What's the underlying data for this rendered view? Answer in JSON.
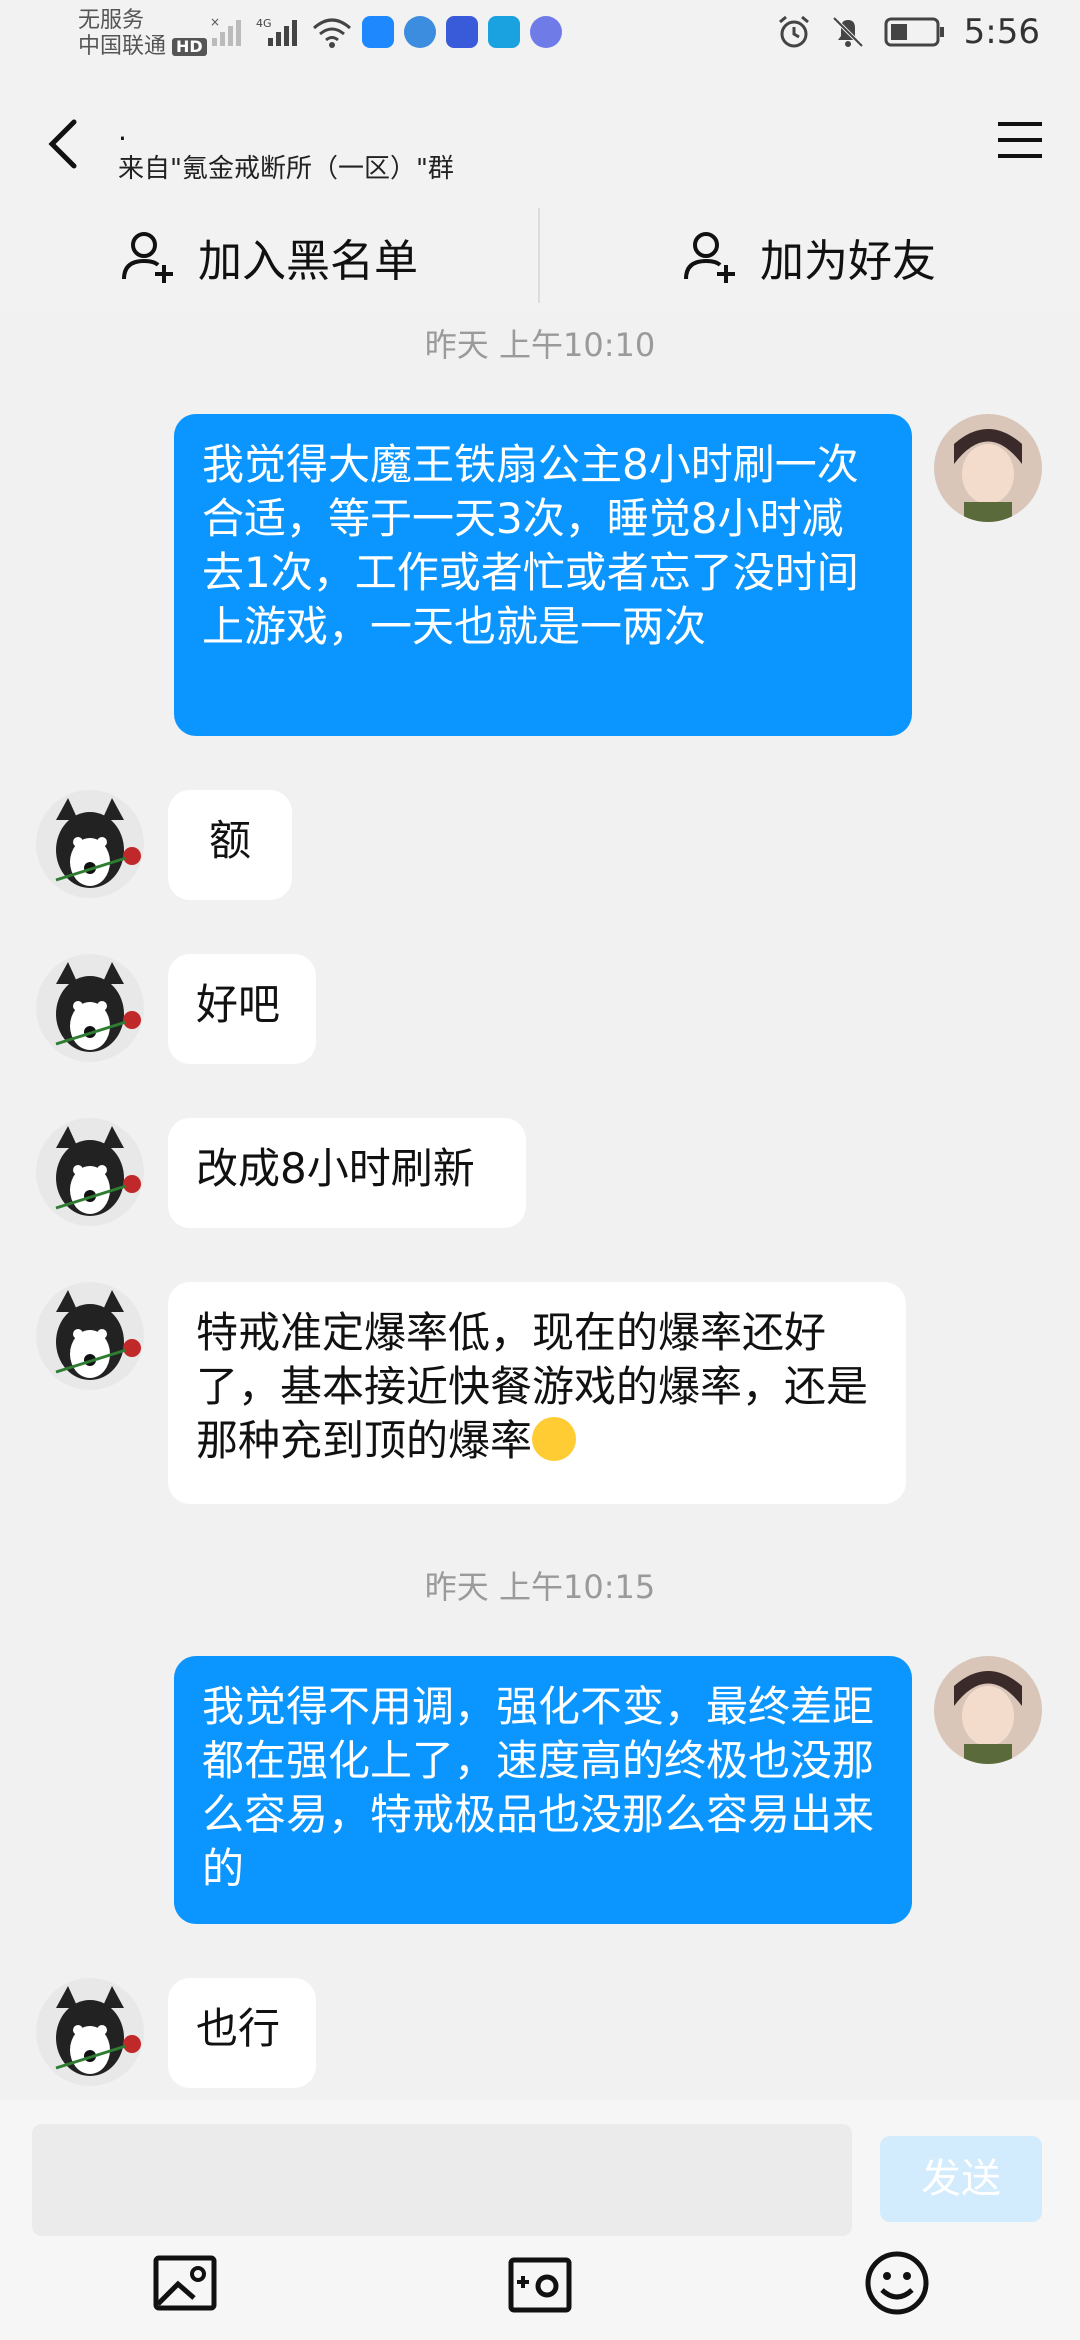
{
  "status_bar": {
    "carrier_line1": "无服务",
    "carrier_line2": "中国联通",
    "hd_badge": "HD",
    "network": "4G",
    "time": "5:56"
  },
  "header": {
    "title": ".",
    "subtitle": "来自\"氪金戒断所（一区）\"群"
  },
  "actions": {
    "blacklist_label": "加入黑名单",
    "add_friend_label": "加为好友"
  },
  "messages": {
    "ts1": "昨天 上午10:10",
    "m1": "我觉得大魔王铁扇公主8小时刷一次合适，等于一天3次，睡觉8小时减去1次，工作或者忙或者忘了没时间上游戏，一天也就是一两次",
    "m2": "额",
    "m3": "好吧",
    "m4": "改成8小时刷新",
    "m5": "特戒准定爆率低，现在的爆率还好了，基本接近快餐游戏的爆率，还是那种充到顶的爆率",
    "ts2": "昨天 上午10:15",
    "m6": "我觉得不用调，强化不变，最终差距都在强化上了，速度高的终极也没那么容易，特戒极品也没那么容易出来的",
    "m7": "也行"
  },
  "composer": {
    "input_value": "",
    "send_label": "发送"
  },
  "colors": {
    "my_bubble": "#0a95ff",
    "send_disabled": "#d2ebfd"
  }
}
